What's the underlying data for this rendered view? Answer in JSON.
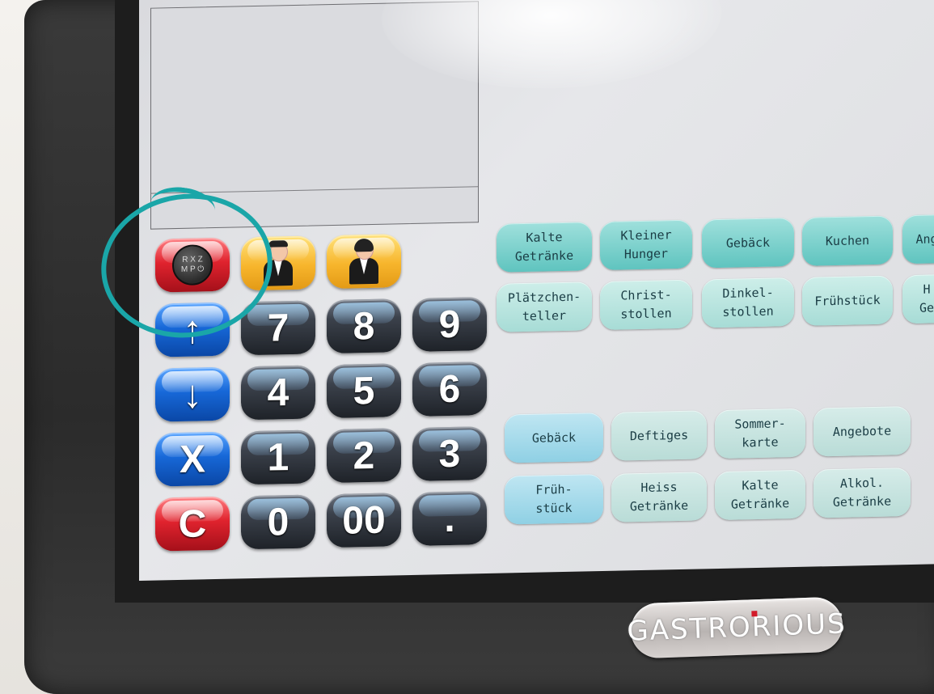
{
  "brand": {
    "logo_text": "GASTRORIOUS"
  },
  "keypad": {
    "rxz_top": "R X Z",
    "rxz_bottom": "M P ⏻",
    "keys": {
      "seven": "7",
      "eight": "8",
      "nine": "9",
      "four": "4",
      "five": "5",
      "six": "6",
      "one": "1",
      "two": "2",
      "three": "3",
      "zero": "0",
      "double_zero": "00",
      "dot": "."
    },
    "up_icon": "arrow-up",
    "down_icon": "arrow-down",
    "x_label": "X",
    "c_label": "C"
  },
  "categories_top": [
    "Kalte\nGetränke",
    "Kleiner\nHunger",
    "Gebäck",
    "Kuchen",
    "Ang",
    "Plätzchen-\nteller",
    "Christ-\nstollen",
    "Dinkel-\nstollen",
    "Frühstück",
    "H\nGe"
  ],
  "categories_bottom": [
    "Gebäck",
    "Deftiges",
    "Sommer-\nkarte",
    "Angebote",
    "Früh-\nstück",
    "Heiss\nGetränke",
    "Kalte\nGetränke",
    "Alkol.\nGetränke"
  ],
  "colors": {
    "annotation": "#1aa6a8",
    "teal_button": "#5fc4bf",
    "red_key": "#e0232e",
    "blue_key": "#1768d8"
  }
}
